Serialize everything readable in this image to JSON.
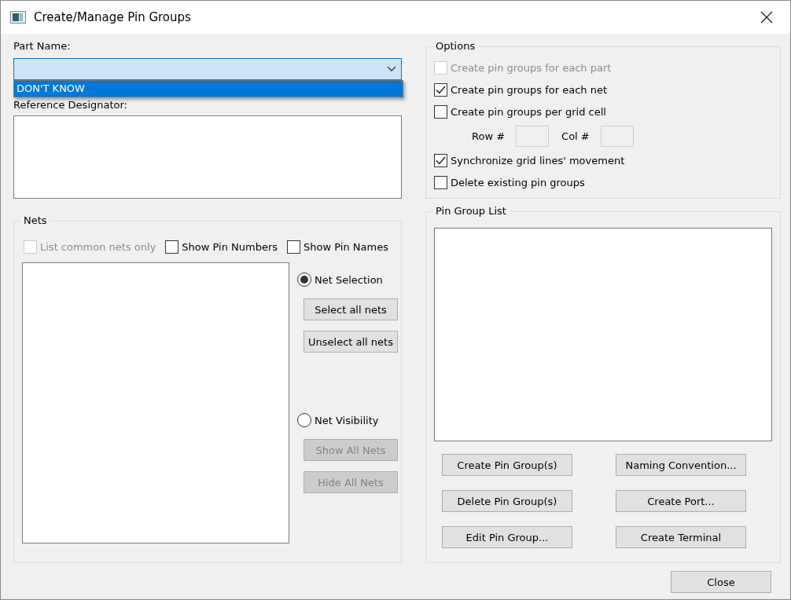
{
  "window": {
    "title": "Create/Manage Pin Groups"
  },
  "part_name": {
    "label": "Part Name:",
    "open": true,
    "options": [
      {
        "label": "DON'T KNOW",
        "selected": true
      }
    ]
  },
  "reference_designator": {
    "label": "Reference Designator:"
  },
  "nets": {
    "title": "Nets",
    "checkboxes": [
      {
        "label": "List common nets only",
        "checked": false,
        "disabled": true
      },
      {
        "label": "Show Pin Numbers",
        "checked": false,
        "disabled": false
      },
      {
        "label": "Show Pin Names",
        "checked": false,
        "disabled": false
      }
    ],
    "modes": [
      {
        "label": "Net Selection",
        "selected": true,
        "buttons": [
          {
            "label": "Select all nets",
            "disabled": false
          },
          {
            "label": "Unselect all nets",
            "disabled": false
          }
        ]
      },
      {
        "label": "Net Visibility",
        "selected": false,
        "buttons": [
          {
            "label": "Show All Nets",
            "disabled": true
          },
          {
            "label": "Hide All Nets",
            "disabled": true
          }
        ]
      }
    ]
  },
  "options": {
    "title": "Options",
    "items": [
      {
        "kind": "checkbox",
        "label": "Create pin groups for each part",
        "checked": false,
        "disabled": true
      },
      {
        "kind": "checkbox",
        "label": "Create pin groups for each net",
        "checked": true,
        "disabled": false
      },
      {
        "kind": "checkbox",
        "label": "Create pin groups per grid cell",
        "checked": false,
        "disabled": false
      },
      {
        "kind": "grid",
        "row_label": "Row #",
        "col_label": "Col #"
      },
      {
        "kind": "checkbox",
        "label": "Synchronize grid lines' movement",
        "checked": true,
        "disabled": false
      },
      {
        "kind": "checkbox",
        "label": "Delete existing pin groups",
        "checked": false,
        "disabled": false
      }
    ]
  },
  "pin_group_list": {
    "title": "Pin Group List",
    "buttons": [
      {
        "label": "Create Pin Group(s)"
      },
      {
        "label": "Naming Convention..."
      },
      {
        "label": "Delete Pin Group(s)"
      },
      {
        "label": "Create Port..."
      },
      {
        "label": "Edit Pin Group..."
      },
      {
        "label": "Create Terminal"
      }
    ]
  },
  "footer_buttons": [
    {
      "label": "Close"
    }
  ]
}
